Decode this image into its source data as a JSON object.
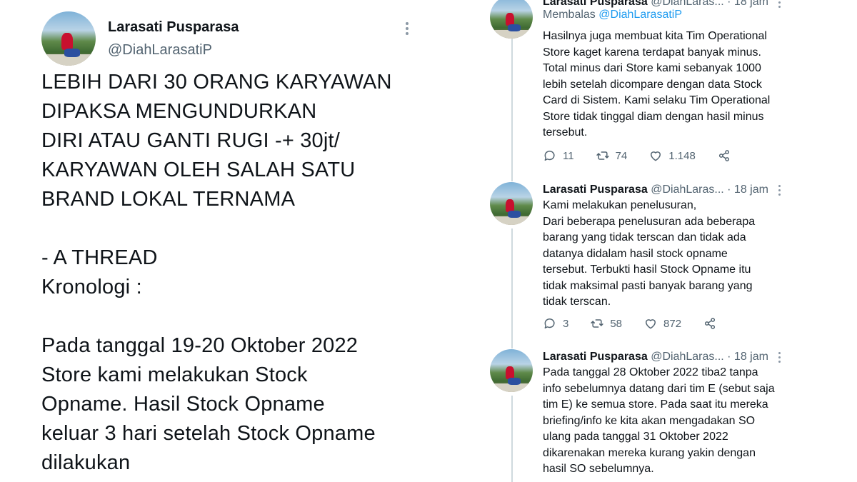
{
  "main_tweet": {
    "name": "Larasati Pusparasa",
    "handle": "@DiahLarasatiP",
    "text": "LEBIH DARI 30 ORANG KARYAWAN\nDIPAKSA MENGUNDURKAN\nDIRI ATAU GANTI RUGI -+ 30jt/\nKARYAWAN OLEH SALAH SATU\nBRAND LOKAL TERNAMA\n\n- A THREAD\nKronologi :\n\nPada tanggal 19-20 Oktober 2022\nStore kami melakukan Stock\nOpname. Hasil Stock Opname\nkeluar 3 hari setelah Stock Opname\ndilakukan"
  },
  "replies": [
    {
      "name": "Larasati Pusparasa",
      "handle_time": "@DiahLaras... · 18 jam",
      "replying_prefix": "Membalas",
      "replying_to": "@DiahLarasatiP",
      "text": "Hasilnya juga membuat kita Tim Operational\nStore kaget karena terdapat banyak minus.\nTotal minus dari Store kami sebanyak 1000\nlebih setelah dicompare dengan data Stock\nCard di Sistem. Kami selaku Tim Operational\nStore tidak tinggal diam dengan hasil minus\ntersebut.",
      "reply_count": "11",
      "retweet_count": "74",
      "like_count": "1.148"
    },
    {
      "name": "Larasati Pusparasa",
      "handle_time": "@DiahLaras... · 18 jam",
      "text": "Kami melakukan penelusuran,\nDari beberapa penelusuran ada beberapa\nbarang yang tidak terscan dan tidak ada\ndatanya didalam hasil stock opname\ntersebut. Terbukti hasil Stock Opname itu\ntidak maksimal pasti banyak barang yang\ntidak terscan.",
      "reply_count": "3",
      "retweet_count": "58",
      "like_count": "872"
    },
    {
      "name": "Larasati Pusparasa",
      "handle_time": "@DiahLaras... · 18 jam",
      "text": "Pada tanggal 28 Oktober 2022 tiba2 tanpa\ninfo sebelumnya datang dari tim E (sebut saja\ntim E) ke semua store. Pada saat itu mereka\nbriefing/info ke kita akan mengadakan SO\nulang pada tanggal 31 Oktober 2022\ndikarenakan mereka kurang yakin dengan\nhasil SO sebelumnya."
    }
  ],
  "icons": {
    "reply": "reply-icon",
    "retweet": "retweet-icon",
    "like": "heart-icon",
    "share": "share-icon",
    "more": "more-icon"
  },
  "colors": {
    "mention": "#1d9bf0",
    "secondary_text": "#536471",
    "thread_line": "#cfd9de"
  }
}
